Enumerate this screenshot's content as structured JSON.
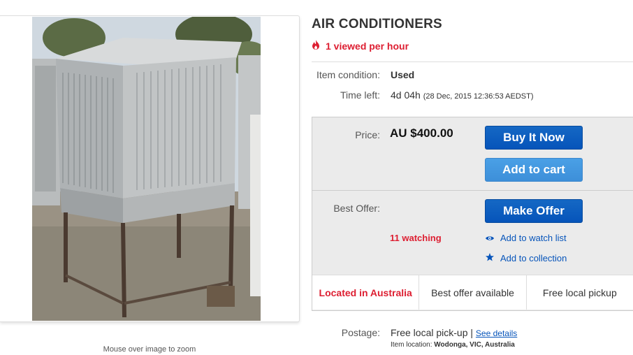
{
  "image": {
    "hint": "Mouse over image to zoom"
  },
  "title": "AIR CONDITIONERS",
  "viewed": "1 viewed per hour",
  "condition": {
    "label": "Item condition:",
    "value": "Used"
  },
  "time_left": {
    "label": "Time left:",
    "value": "4d 04h",
    "detail": "(28 Dec, 2015   12:36:53 AEDST)"
  },
  "price": {
    "label": "Price:",
    "value": "AU $400.00"
  },
  "buttons": {
    "buy_now": "Buy It Now",
    "add_to_cart": "Add to cart",
    "make_offer": "Make Offer"
  },
  "best_offer": {
    "label": "Best Offer:"
  },
  "watching": "11 watching",
  "links": {
    "watch_list": "Add to watch list",
    "collection": "Add to collection"
  },
  "highlights": [
    "Located in Australia",
    "Best offer available",
    "Free local pickup"
  ],
  "postage": {
    "label": "Postage:",
    "value": "Free local pick-up",
    "separator": "|",
    "details_link": "See details",
    "location_label": "Item location:",
    "location_value": "Wodonga, VIC, Australia"
  },
  "colors": {
    "accent_red": "#dd1e31",
    "link_blue": "#0654ba",
    "button_blue": "#0654ba"
  },
  "icons": [
    "flame-icon",
    "eye-icon",
    "star-icon"
  ]
}
